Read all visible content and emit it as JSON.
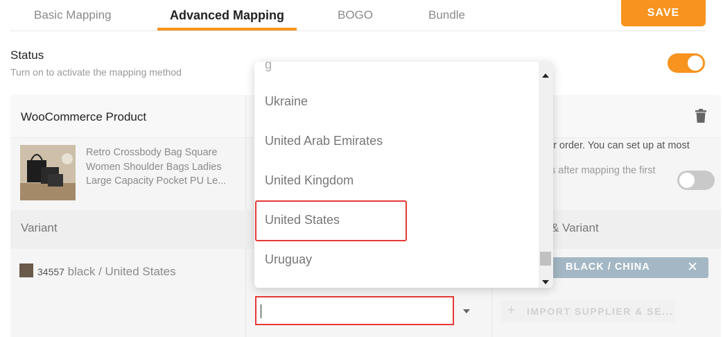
{
  "tabs": [
    {
      "label": "Basic Mapping"
    },
    {
      "label": "Advanced Mapping"
    },
    {
      "label": "BOGO"
    },
    {
      "label": "Bundle"
    }
  ],
  "toolbar": {
    "save_label": "SAVE"
  },
  "status": {
    "title": "Status",
    "subtitle": "Turn on to activate the mapping method",
    "enabled": true
  },
  "panel": {
    "title": "WooCommerce Product",
    "product_title": "Retro Crossbody Bag Square Women Shoulder Bags Ladies Large Capacity Pocket PU Le...",
    "right_text_1": "ur order. You can set up at most",
    "right_text_2": "ts after mapping the first",
    "secondary_toggle_enabled": false,
    "variant_header": "Variant",
    "variant_header_right": "& Variant",
    "variant_row": {
      "sku": "34557",
      "label": "black / United States"
    },
    "supplier_chip": "BLACK / CHINA",
    "import_button": "IMPORT SUPPLIER & SE..."
  },
  "dropdown": {
    "options": [
      "Ukraine",
      "United Arab Emirates",
      "United Kingdom",
      "United States",
      "Uruguay"
    ],
    "partial_option_top": "g",
    "input_value": ""
  },
  "colors": {
    "accent": "#f7931e",
    "highlight": "#e53935",
    "chip": "#a4b7c4"
  }
}
